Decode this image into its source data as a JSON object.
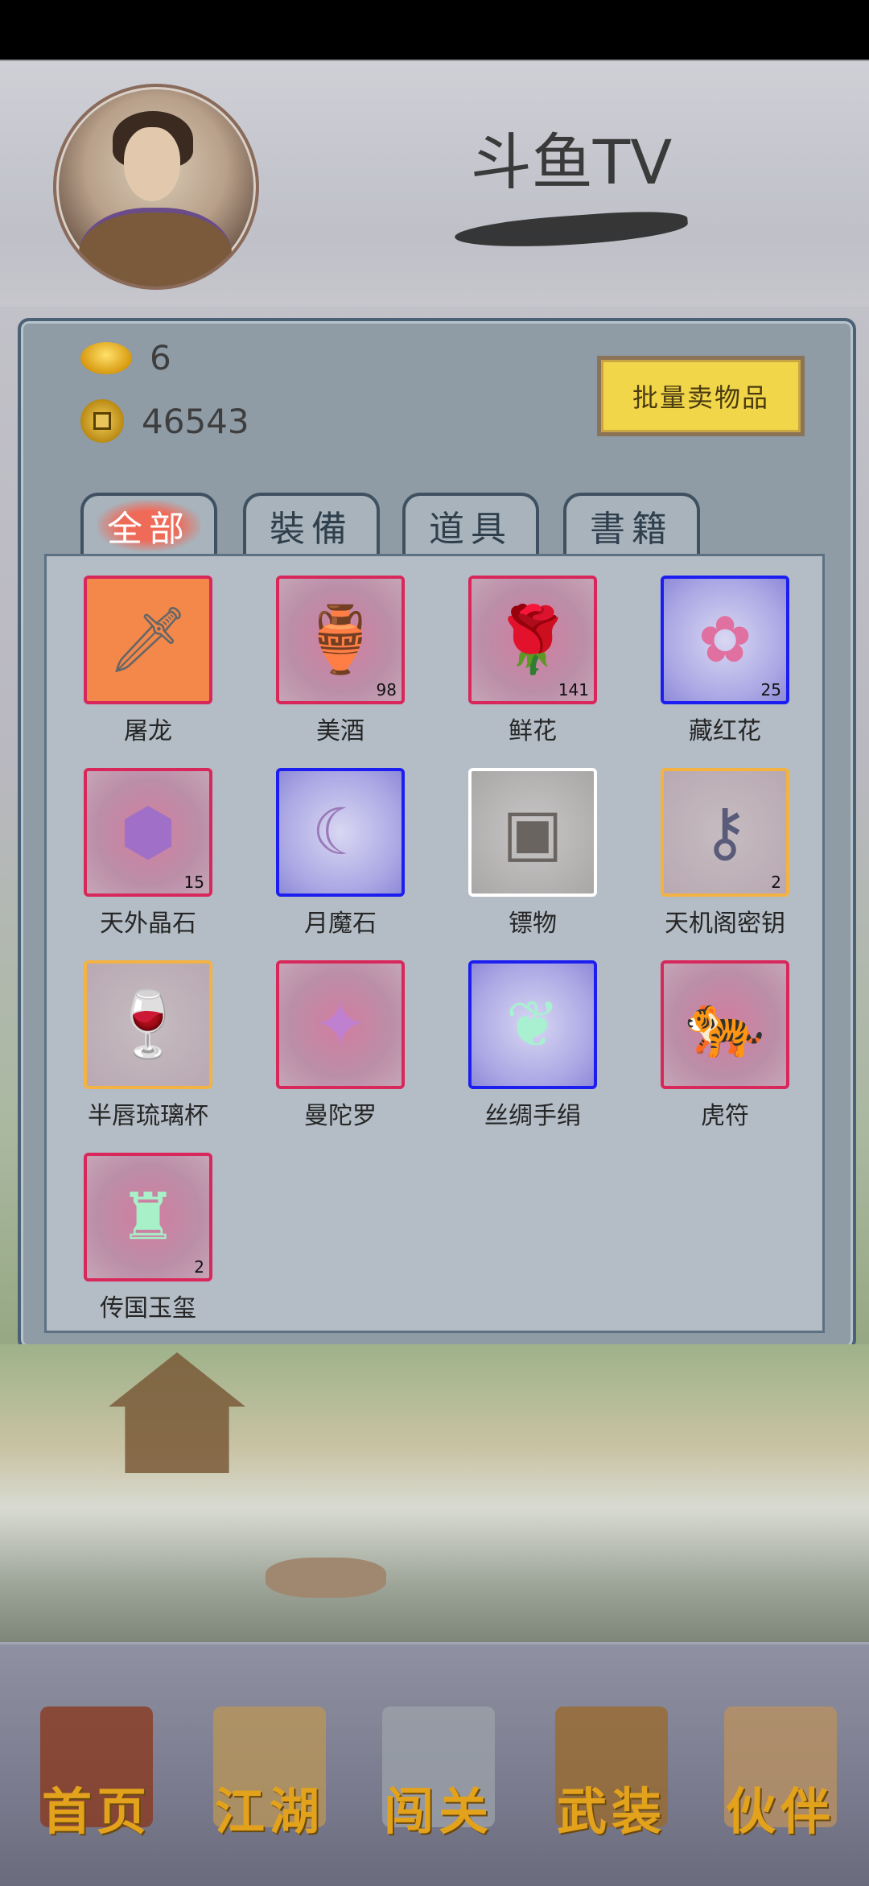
{
  "header": {
    "title": "斗鱼TV"
  },
  "resources": {
    "gold_ingot": "6",
    "coins": "46543"
  },
  "sell_button": "批量卖物品",
  "tabs": [
    {
      "label": "全部",
      "active": true
    },
    {
      "label": "裝備",
      "active": false
    },
    {
      "label": "道具",
      "active": false
    },
    {
      "label": "書籍",
      "active": false
    }
  ],
  "items": [
    {
      "name": "屠龙",
      "count": "",
      "rarity": "orange-red",
      "icon": "sword-icon",
      "glyph": "🗡"
    },
    {
      "name": "美酒",
      "count": "98",
      "rarity": "red",
      "icon": "wine-jar-icon",
      "glyph": "🏺"
    },
    {
      "name": "鲜花",
      "count": "141",
      "rarity": "red",
      "icon": "rose-icon",
      "glyph": "🌹"
    },
    {
      "name": "藏红花",
      "count": "25",
      "rarity": "blue",
      "icon": "saffron-flower-icon",
      "glyph": "✿"
    },
    {
      "name": "天外晶石",
      "count": "15",
      "rarity": "red",
      "icon": "crystal-icon",
      "glyph": "⬢"
    },
    {
      "name": "月魔石",
      "count": "",
      "rarity": "blue",
      "icon": "moon-stone-icon",
      "glyph": "☾"
    },
    {
      "name": "镖物",
      "count": "",
      "rarity": "white",
      "icon": "cargo-box-icon",
      "glyph": "▣"
    },
    {
      "name": "天机阁密钥",
      "count": "2",
      "rarity": "orange",
      "icon": "key-icon",
      "glyph": "⚷"
    },
    {
      "name": "半唇琉璃杯",
      "count": "",
      "rarity": "orange",
      "icon": "glass-cup-icon",
      "glyph": "🍷"
    },
    {
      "name": "曼陀罗",
      "count": "",
      "rarity": "red",
      "icon": "datura-flower-icon",
      "glyph": "✦"
    },
    {
      "name": "丝绸手绢",
      "count": "",
      "rarity": "blue",
      "icon": "silk-handkerchief-icon",
      "glyph": "❦"
    },
    {
      "name": "虎符",
      "count": "",
      "rarity": "red",
      "icon": "tiger-tally-icon",
      "glyph": "🐅"
    },
    {
      "name": "传国玉玺",
      "count": "2",
      "rarity": "red",
      "icon": "jade-seal-icon",
      "glyph": "♜"
    }
  ],
  "close_button": "✕",
  "bottom_nav": [
    {
      "label": "首页",
      "icon": "home-hall-icon",
      "color": "#8a3a20"
    },
    {
      "label": "江湖",
      "icon": "scroll-map-icon",
      "color": "#b8955a"
    },
    {
      "label": "闯关",
      "icon": "crossed-swords-icon",
      "color": "#9aa0a8"
    },
    {
      "label": "武装",
      "icon": "armor-icon",
      "color": "#9a6a30"
    },
    {
      "label": "伙伴",
      "icon": "companions-icon",
      "color": "#b89060"
    }
  ]
}
